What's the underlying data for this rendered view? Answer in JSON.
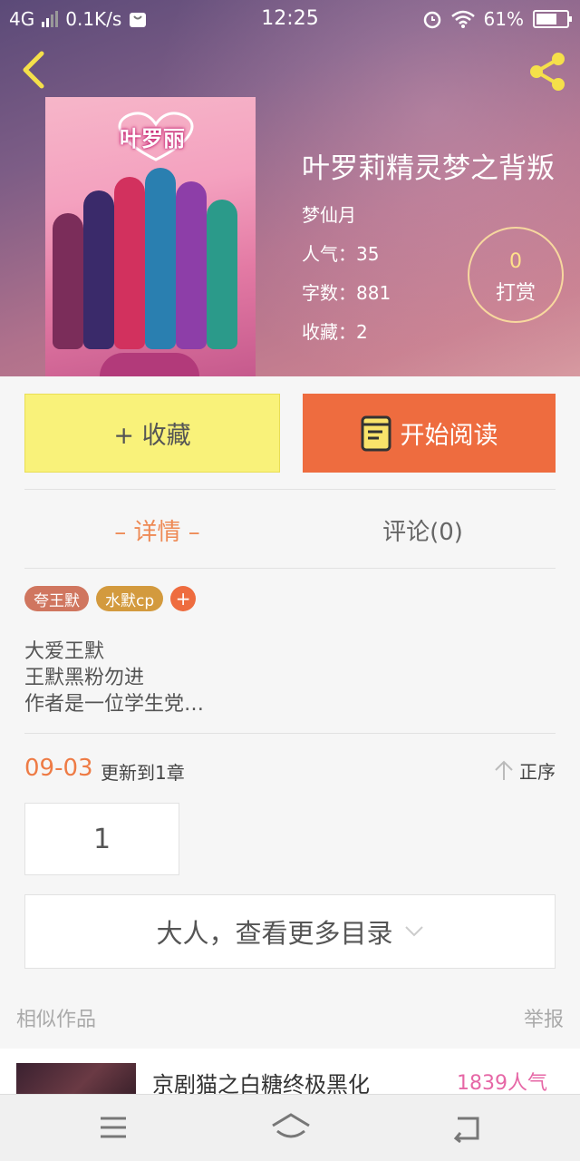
{
  "status_bar": {
    "network": "4G",
    "speed": "0.1K/s",
    "time": "12:25",
    "battery": "61%"
  },
  "book": {
    "cover_title": "叶罗丽",
    "title": "叶罗莉精灵梦之背叛",
    "author": "梦仙月",
    "popularity": "人气：35",
    "word_count": "字数：881",
    "favorites": "收藏：2"
  },
  "reward": {
    "count": "0",
    "label": "打赏"
  },
  "actions": {
    "favorite": "+ 收藏",
    "read": "开始阅读"
  },
  "tabs": {
    "detail": "– 详情 –",
    "comment": "评论(0)"
  },
  "tags": [
    {
      "label": "夸王默",
      "color": "#d0765f"
    },
    {
      "label": "水默cp",
      "color": "#d39a3e"
    }
  ],
  "tag_add": "+",
  "description": [
    "大爱王默",
    "王默黑粉勿进",
    "作者是一位学生党…"
  ],
  "update": {
    "date": "09-03",
    "text": "更新到1章",
    "order": "正序"
  },
  "chapters": [
    "1"
  ],
  "more_catalog": "大人，查看更多目录",
  "similar": {
    "heading": "相似作品",
    "report": "举报",
    "items": [
      {
        "title": "京剧猫之白糖终极黑化",
        "popularity": "1839人气"
      }
    ]
  },
  "colors": {
    "accent_orange": "#ee6c3f",
    "fav_yellow": "#f9f27a",
    "popularity_pink": "#e667a6"
  }
}
